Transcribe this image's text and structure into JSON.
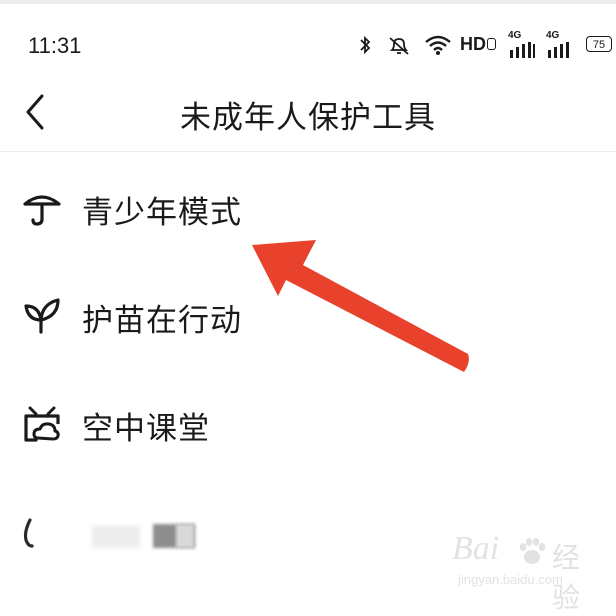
{
  "status_bar": {
    "time": "11:31",
    "network_label": "HD",
    "signal_1_label": "4G",
    "signal_2_label": "4G",
    "battery": "75"
  },
  "nav": {
    "title": "未成年人保护工具"
  },
  "menu": {
    "items": [
      {
        "label": "青少年模式",
        "icon": "umbrella-icon"
      },
      {
        "label": "护苗在行动",
        "icon": "sprout-icon"
      },
      {
        "label": "空中课堂",
        "icon": "classroom-icon"
      }
    ]
  },
  "watermark": {
    "brand": "Bai",
    "brand_cn": "经验",
    "url": "jingyan.baidu.com"
  },
  "colors": {
    "annotation_arrow": "#e8412c",
    "text": "#1a1a1a",
    "divider": "#ececec"
  }
}
